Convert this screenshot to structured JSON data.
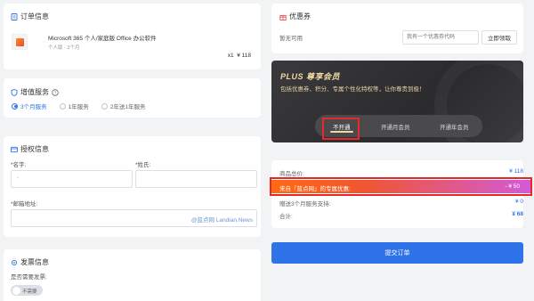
{
  "order": {
    "title": "订单信息",
    "product_name": "Microsoft 365 个人/家庭版 Office 办公软件",
    "product_spec": "个人版 - 3个月",
    "qty_price": "x1  ¥ 118"
  },
  "value_add": {
    "title": "增值服务",
    "options": [
      "3个月服务",
      "1年服务",
      "2年送1年服务"
    ],
    "selected": 0
  },
  "auth": {
    "title": "授权信息",
    "last_name_label": "*名字:",
    "first_name_label": "*姓氏:",
    "email_label": "*邮箱地址:",
    "last_name_value": "-",
    "watermark": "@蓝点网 Landian.News"
  },
  "invoice": {
    "title": "发票信息",
    "question": "是否需要发票:",
    "toggle_label": "不需要"
  },
  "coupon": {
    "title": "优惠券",
    "status": "暂无可用",
    "placeholder": "我有一个优惠券代码",
    "redeem_label": "立即领取"
  },
  "plus": {
    "title": "PLUS 尊享会员",
    "subtitle": "包括优惠券、积分、专属个性化特权等，让你尊贵到极！",
    "tabs": [
      "不开通",
      "开通月会员",
      "开通年会员"
    ],
    "selected": 0
  },
  "summary": {
    "rows": [
      {
        "label": "商品总价:",
        "value": "¥ 118"
      },
      {
        "label": "来自『蓝点网』的专属优惠:",
        "value": "- ¥ 50"
      },
      {
        "label": "赠送3个月服务支持:",
        "value": "¥ 0"
      },
      {
        "label": "合计:",
        "value": "¥ 68"
      }
    ]
  },
  "submit_label": "提交订单",
  "colors": {
    "accent": "#2f73e8",
    "highlight_box": "#e8272a",
    "promo_gradient_start": "#ff6a13",
    "promo_gradient_end": "#d35ad8",
    "plus_gold": "#f3d9a6"
  }
}
